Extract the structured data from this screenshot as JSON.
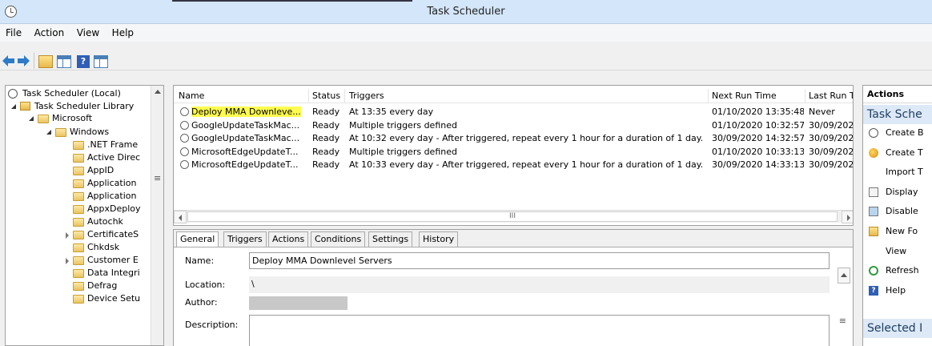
{
  "window": {
    "title": "Task Scheduler"
  },
  "menu": [
    "File",
    "Action",
    "View",
    "Help"
  ],
  "tree": {
    "items": [
      {
        "label": "Task Scheduler (Local)",
        "level": 0,
        "icon": "clock-icon",
        "expander": ""
      },
      {
        "label": "Task Scheduler Library",
        "level": 1,
        "icon": "library-icon",
        "expander": "open"
      },
      {
        "label": "Microsoft",
        "level": 2,
        "icon": "folder-icon",
        "expander": "open"
      },
      {
        "label": "Windows",
        "level": 3,
        "icon": "folder-icon",
        "expander": "open"
      },
      {
        "label": ".NET Frame",
        "level": 4,
        "icon": "folder-icon",
        "expander": ""
      },
      {
        "label": "Active Direc",
        "level": 4,
        "icon": "folder-icon",
        "expander": ""
      },
      {
        "label": "AppID",
        "level": 4,
        "icon": "folder-icon",
        "expander": ""
      },
      {
        "label": "Application",
        "level": 4,
        "icon": "folder-icon",
        "expander": ""
      },
      {
        "label": "Application",
        "level": 4,
        "icon": "folder-icon",
        "expander": ""
      },
      {
        "label": "AppxDeploy",
        "level": 4,
        "icon": "folder-icon",
        "expander": ""
      },
      {
        "label": "Autochk",
        "level": 4,
        "icon": "folder-icon",
        "expander": ""
      },
      {
        "label": "CertificateS",
        "level": 4,
        "icon": "folder-icon",
        "expander": "closed"
      },
      {
        "label": "Chkdsk",
        "level": 4,
        "icon": "folder-icon",
        "expander": ""
      },
      {
        "label": "Customer E",
        "level": 4,
        "icon": "folder-icon",
        "expander": "closed"
      },
      {
        "label": "Data Integri",
        "level": 4,
        "icon": "folder-icon",
        "expander": ""
      },
      {
        "label": "Defrag",
        "level": 4,
        "icon": "folder-icon",
        "expander": ""
      },
      {
        "label": "Device Setu",
        "level": 4,
        "icon": "folder-icon",
        "expander": ""
      }
    ],
    "scroll_grip": "≡"
  },
  "tasks": {
    "columns": [
      "Name",
      "Status",
      "Triggers",
      "Next Run Time",
      "Last Run T"
    ],
    "rows": [
      {
        "name": "Deploy MMA Downleve...",
        "status": "Ready",
        "triggers": "At 13:35 every day",
        "next_run": "01/10/2020 13:35:48",
        "last_run": "Never",
        "selected": true
      },
      {
        "name": "GoogleUpdateTaskMac...",
        "status": "Ready",
        "triggers": "Multiple triggers defined",
        "next_run": "01/10/2020 10:32:57",
        "last_run": "30/09/2020",
        "selected": false
      },
      {
        "name": "GoogleUpdateTaskMac...",
        "status": "Ready",
        "triggers": "At 10:32 every day - After triggered, repeat every 1 hour for a duration of 1 day.",
        "next_run": "30/09/2020 14:32:57",
        "last_run": "30/09/2020",
        "selected": false
      },
      {
        "name": "MicrosoftEdgeUpdateT...",
        "status": "Ready",
        "triggers": "Multiple triggers defined",
        "next_run": "01/10/2020 10:33:13",
        "last_run": "30/09/2020",
        "selected": false
      },
      {
        "name": "MicrosoftEdgeUpdateT...",
        "status": "Ready",
        "triggers": "At 10:33 every day - After triggered, repeat every 1 hour for a duration of 1 day.",
        "next_run": "30/09/2020 14:33:13",
        "last_run": "30/09/2020",
        "selected": false
      }
    ],
    "scroll_thumb": "III"
  },
  "details": {
    "tabs": [
      "General",
      "Triggers",
      "Actions",
      "Conditions",
      "Settings",
      "History"
    ],
    "active_tab": "General",
    "name_label": "Name:",
    "name_value": "Deploy MMA Downlevel Servers",
    "location_label": "Location:",
    "location_value": "\\",
    "author_label": "Author:",
    "description_label": "Description:",
    "scroll_grip": "≡"
  },
  "actions": {
    "header": "Actions",
    "section_title": "Task Sche",
    "items": [
      {
        "label": "Create B",
        "icon": "create-basic-task-icon"
      },
      {
        "label": "Create T",
        "icon": "create-task-icon"
      },
      {
        "label": "Import T",
        "icon": ""
      },
      {
        "label": "Display",
        "icon": "display-running-icon"
      },
      {
        "label": "Disable",
        "icon": "disable-history-icon"
      },
      {
        "label": "New Fo",
        "icon": "new-folder-icon"
      },
      {
        "label": "View",
        "icon": ""
      },
      {
        "label": "Refresh",
        "icon": "refresh-icon"
      },
      {
        "label": "Help",
        "icon": "help-icon"
      }
    ],
    "help_glyph": "?",
    "selected_section": "Selected I"
  }
}
